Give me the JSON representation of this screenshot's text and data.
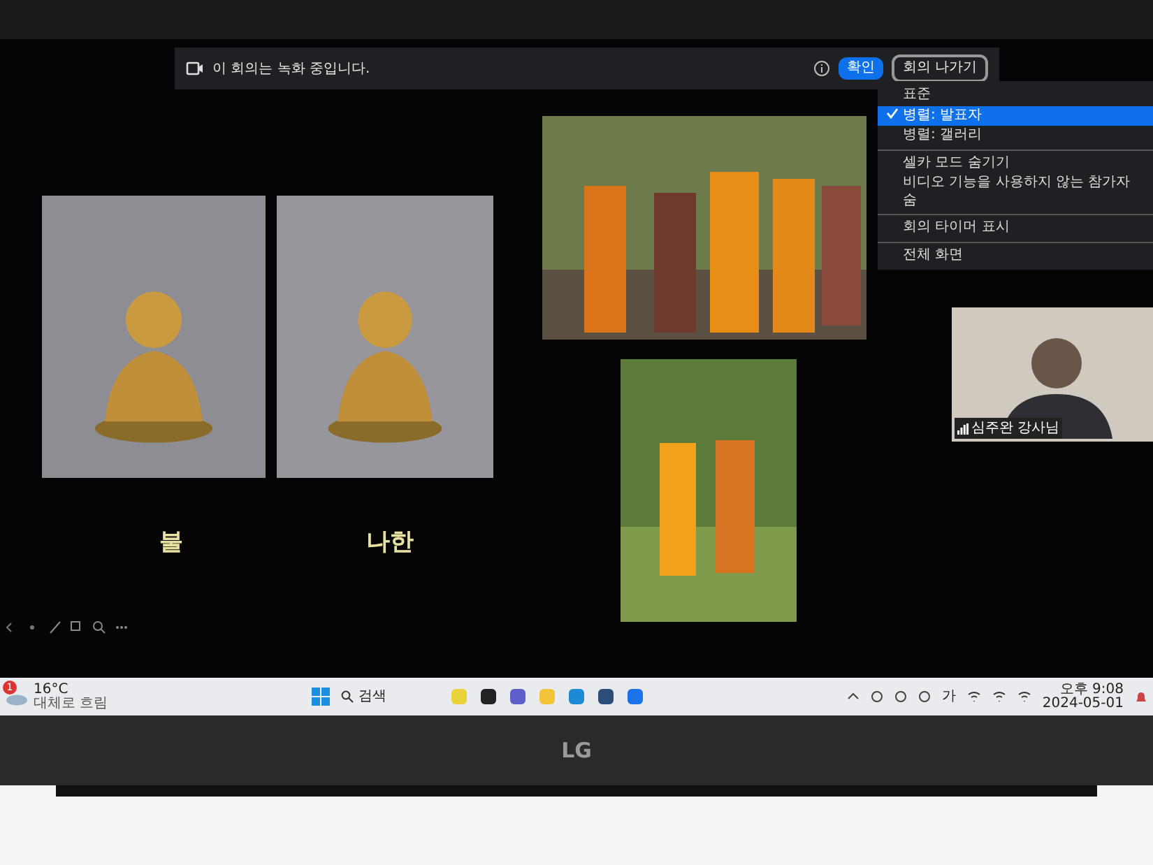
{
  "meeting_bar": {
    "recording_notice": "이 회의는 녹화 중입니다.",
    "confirm_button": "확인",
    "leave_button": "회의 나가기"
  },
  "view_menu": {
    "sections": [
      {
        "items": [
          {
            "label": "표준",
            "selected": false
          },
          {
            "label": "병렬: 발표자",
            "selected": true
          },
          {
            "label": "병렬: 갤러리",
            "selected": false
          }
        ]
      },
      {
        "items": [
          {
            "label": "셀카 모드 숨기기"
          },
          {
            "label": "비디오 기능을 사용하지 않는 참가자 숨"
          }
        ]
      },
      {
        "items": [
          {
            "label": "회의 타이머 표시"
          }
        ]
      },
      {
        "items": [
          {
            "label": "전체 화면"
          }
        ]
      }
    ]
  },
  "slide": {
    "captions": [
      "불",
      "나한"
    ]
  },
  "video_tile": {
    "participant_name": "심주완 강사님"
  },
  "taskbar": {
    "weather": {
      "badge": "1",
      "temperature": "16°C",
      "condition": "대체로 흐림"
    },
    "search_label": "검색",
    "ime": "가",
    "time": "오후 9:08",
    "date": "2024-05-01"
  },
  "laptop": {
    "logo": "LG"
  }
}
